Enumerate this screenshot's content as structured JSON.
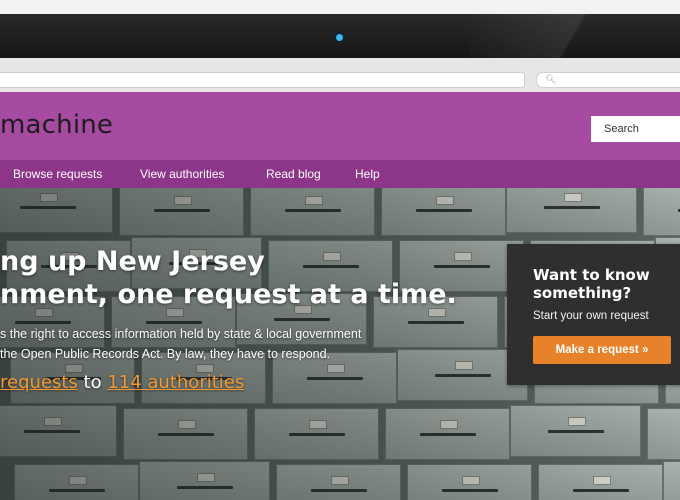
{
  "site": {
    "logo_text": "machine",
    "search_placeholder": "Search",
    "nav": [
      {
        "label": "Browse requests"
      },
      {
        "label": "View authorities"
      },
      {
        "label": "Read blog"
      },
      {
        "label": "Help"
      }
    ]
  },
  "hero": {
    "heading_line1": "ng up New Jersey",
    "heading_line2": "nment, one request at a time.",
    "intro_line1": "s the right to access information held by state & local government",
    "intro_line2": "the Open Public Records Act. By law, they have to respond.",
    "stats": {
      "requests_link": "requests",
      "connector": " to ",
      "authorities_link": "114 authorities"
    }
  },
  "cta": {
    "title": "Want to know something?",
    "subtitle": "Start your own request",
    "button_label": "Make a request »"
  },
  "colors": {
    "header_purple": "#a64aa2",
    "nav_purple": "#8c3589",
    "accent_orange": "#e8822a",
    "link_orange": "#f39a33"
  },
  "icons": {
    "browser_search": "search-icon",
    "camera": "camera-icon"
  }
}
